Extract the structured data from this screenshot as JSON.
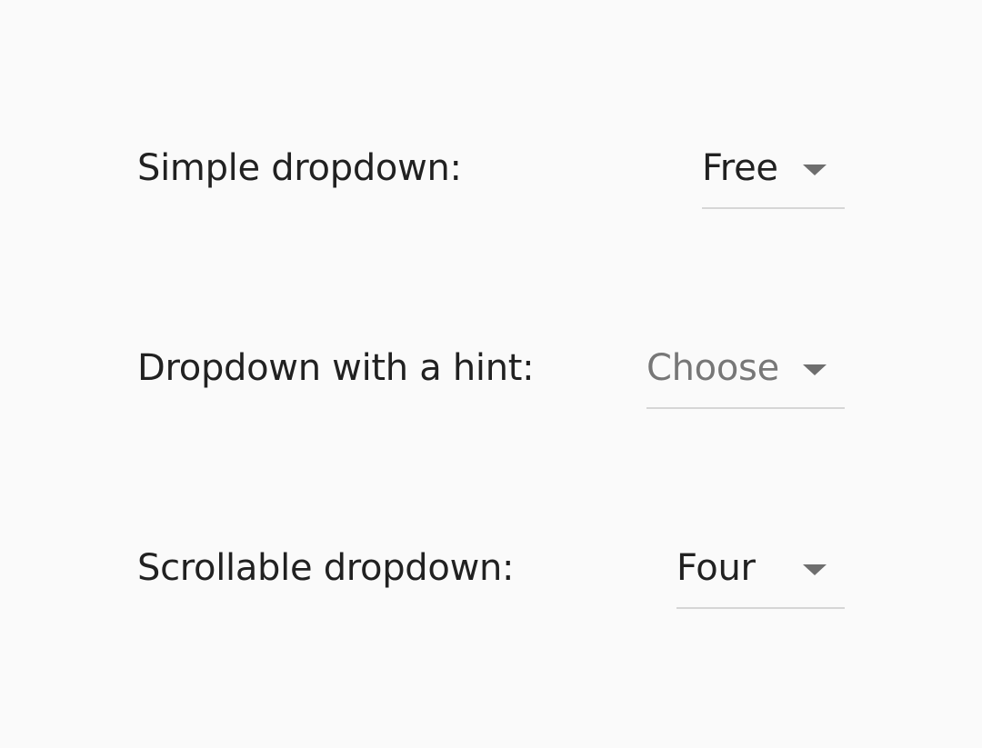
{
  "dropdowns": [
    {
      "label": "Simple dropdown:",
      "value": "Free",
      "is_hint": false
    },
    {
      "label": "Dropdown with a hint:",
      "value": "Choose",
      "is_hint": true
    },
    {
      "label": "Scrollable dropdown:",
      "value": "Four",
      "is_hint": false
    }
  ],
  "colors": {
    "background": "#fafafa",
    "text": "#212121",
    "hint_text": "#777777",
    "caret": "#6e6e6e",
    "underline": "#d6d6d6"
  },
  "icons": {
    "caret": "arrow-drop-down-icon"
  }
}
